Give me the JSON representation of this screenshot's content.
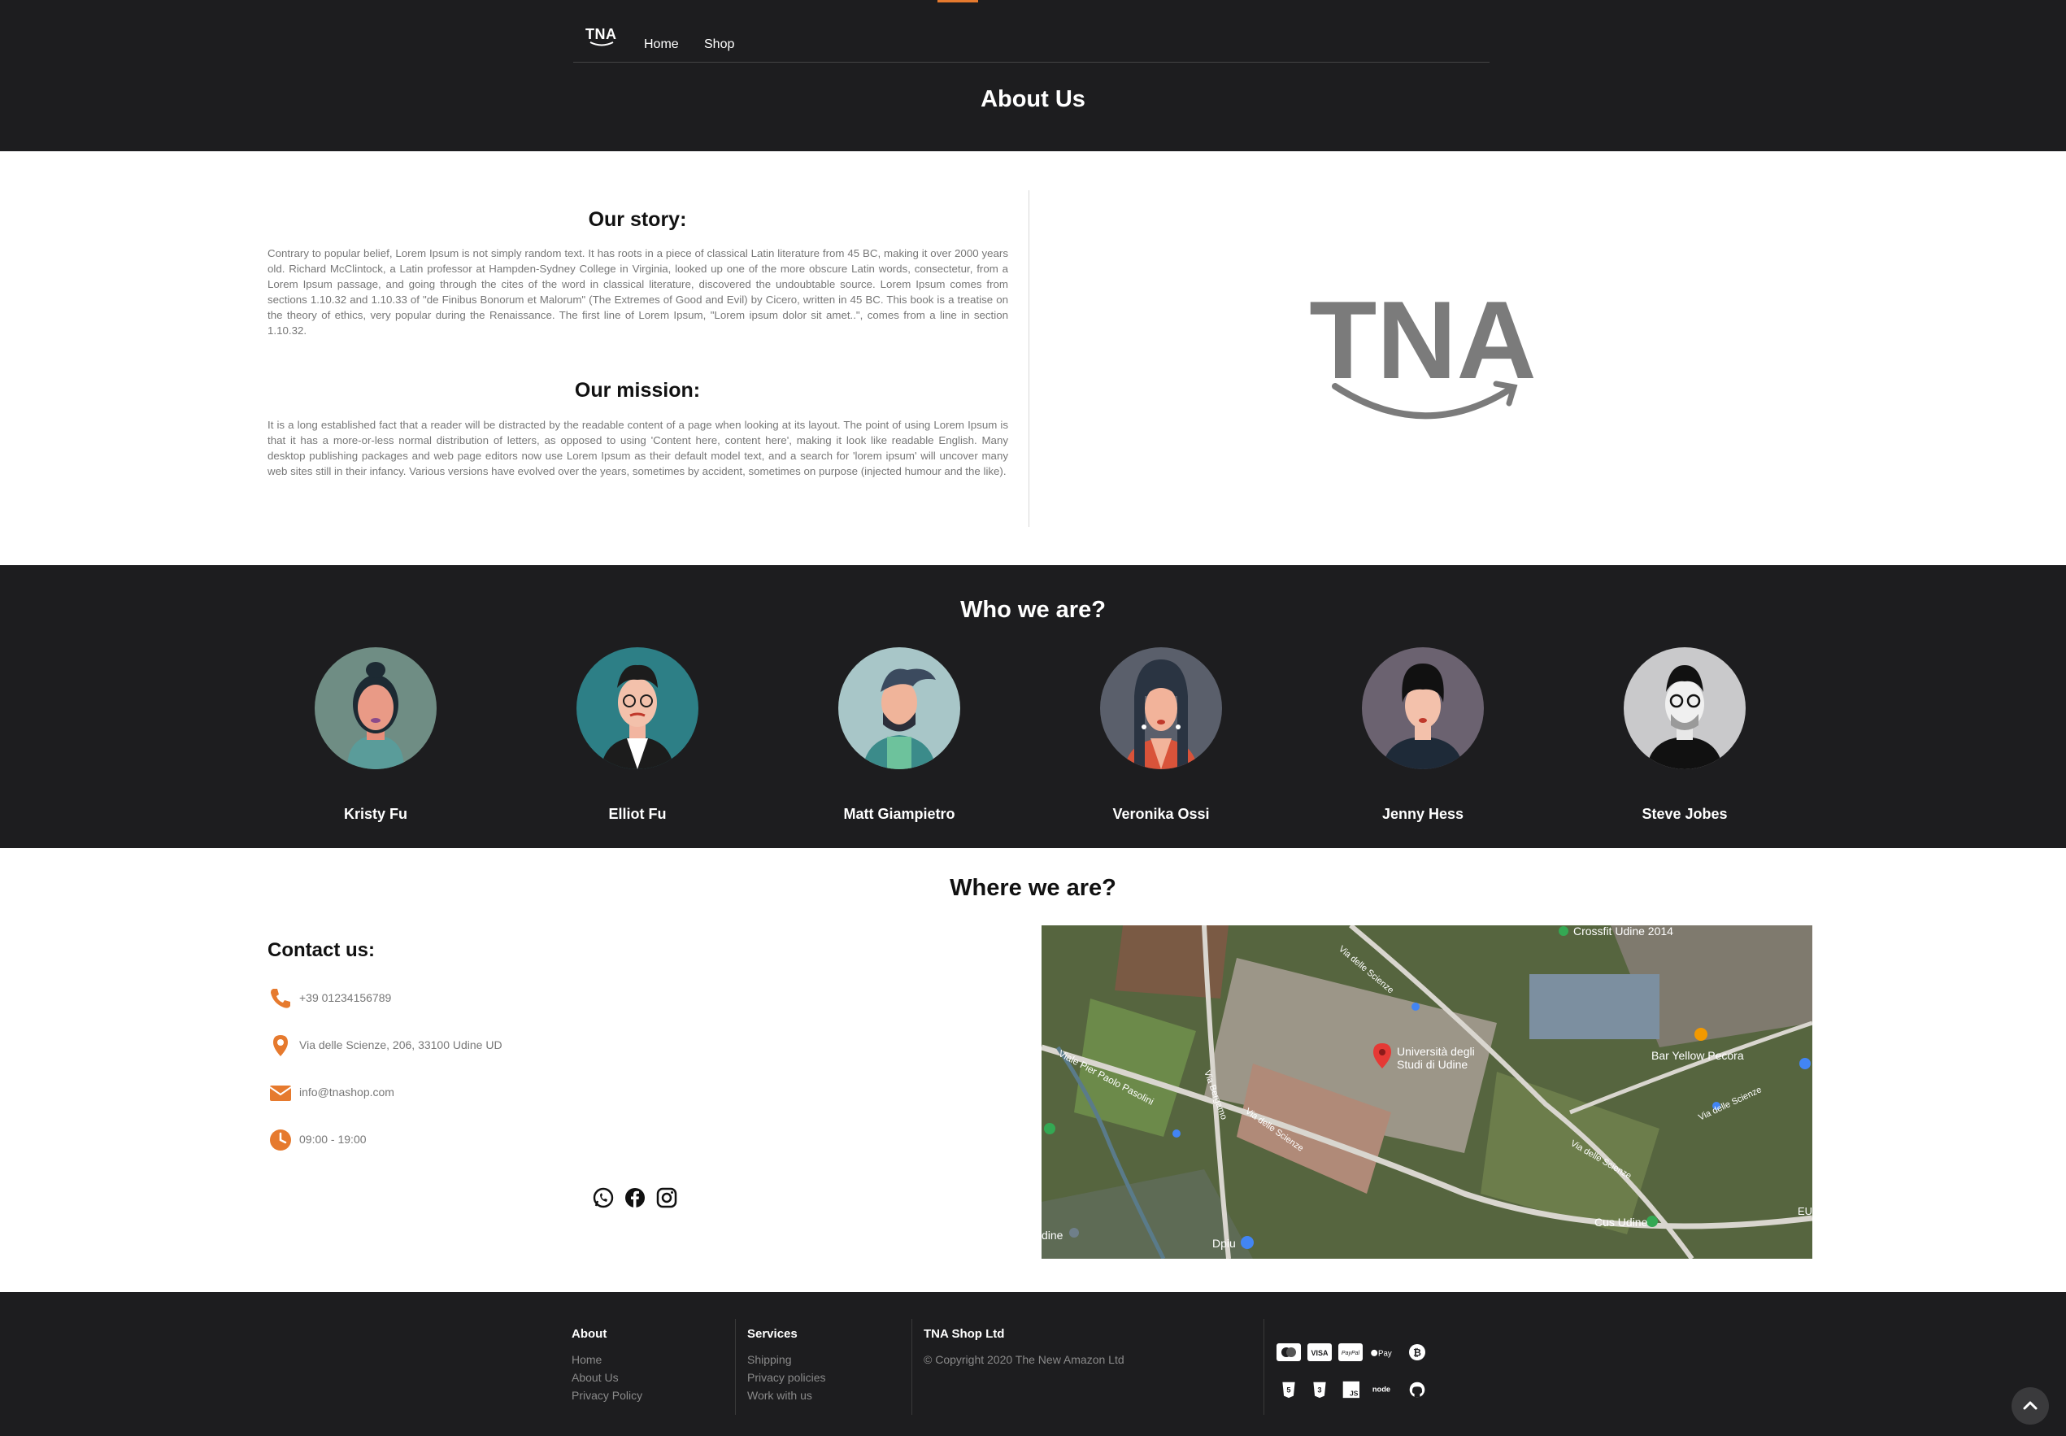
{
  "header": {
    "logo_text": "TNA",
    "nav": [
      "Home",
      "Shop"
    ],
    "title": "About Us"
  },
  "about": {
    "story_heading": "Our story:",
    "story_text": "Contrary to popular belief, Lorem Ipsum is not simply random text. It has roots in a piece of classical Latin literature from 45 BC, making it over 2000 years old. Richard McClintock, a Latin professor at Hampden-Sydney College in Virginia, looked up one of the more obscure Latin words, consectetur, from a Lorem Ipsum passage, and going through the cites of the word in classical literature, discovered the undoubtable source. Lorem Ipsum comes from sections 1.10.32 and 1.10.33 of \"de Finibus Bonorum et Malorum\" (The Extremes of Good and Evil) by Cicero, written in 45 BC. This book is a treatise on the theory of ethics, very popular during the Renaissance. The first line of Lorem Ipsum, \"Lorem ipsum dolor sit amet..\", comes from a line in section 1.10.32.",
    "mission_heading": "Our mission:",
    "mission_text": "It is a long established fact that a reader will be distracted by the readable content of a page when looking at its layout. The point of using Lorem Ipsum is that it has a more-or-less normal distribution of letters, as opposed to using 'Content here, content here', making it look like readable English. Many desktop publishing packages and web page editors now use Lorem Ipsum as their default model text, and a search for 'lorem ipsum' will uncover many web sites still in their infancy. Various versions have evolved over the years, sometimes by accident, sometimes on purpose (injected humour and the like).",
    "logo_text": "TNA",
    "logo_color": "#7b7b7b"
  },
  "team": {
    "heading": "Who we are?",
    "members": [
      {
        "name": "Kristy Fu",
        "bg": "#6f8d84"
      },
      {
        "name": "Elliot Fu",
        "bg": "#2d7f86"
      },
      {
        "name": "Matt Giampietro",
        "bg": "#a8c6c8"
      },
      {
        "name": "Veronika Ossi",
        "bg": "#5a5f6b"
      },
      {
        "name": "Jenny Hess",
        "bg": "#6b6270"
      },
      {
        "name": "Steve Jobes",
        "bg": "#c9c9cb"
      }
    ]
  },
  "location": {
    "heading": "Where we are?",
    "contact_heading": "Contact us:",
    "phone": "+39 01234156789",
    "address": "Via delle Scienze, 206, 33100 Udine UD",
    "email": "info@tnashop.com",
    "hours": "09:00 - 19:00",
    "accent": "#e67a2e",
    "social": [
      "whatsapp-icon",
      "facebook-icon",
      "instagram-icon"
    ],
    "map_labels": {
      "university": "Università degli Studi di Udine",
      "crossfit": "Crossfit Udine 2014",
      "bar": "Bar Yellow Pecora",
      "cus": "Cus Udine",
      "dpiu": "Dpiu",
      "udine": "dine",
      "eu": "EU",
      "street1": "Viale Pier Paolo Pasolini",
      "street2": "Via delle Scienze",
      "street3": "Via Bergamo",
      "street4": "Via delle Scienze",
      "street5": "Via delle Scienze",
      "street6": "Via delle Scienze"
    }
  },
  "footer": {
    "about_heading": "About",
    "about_links": [
      "Home",
      "About Us",
      "Privacy Policy"
    ],
    "services_heading": "Services",
    "services_links": [
      "Shipping",
      "Privacy policies",
      "Work with us"
    ],
    "company_heading": "TNA Shop Ltd",
    "copyright": "© Copyright 2020 The New Amazon Ltd",
    "payment_icons": [
      "mastercard-icon",
      "visa-icon",
      "paypal-icon",
      "apple-pay-icon",
      "bitcoin-icon"
    ],
    "tech_icons": [
      "html5-icon",
      "css3-icon",
      "js-icon",
      "node-icon",
      "github-icon"
    ],
    "pay_labels": {
      "visa": "VISA",
      "paypal": "PayPal",
      "applepay": "Pay",
      "js": "JS",
      "node": "node"
    }
  }
}
